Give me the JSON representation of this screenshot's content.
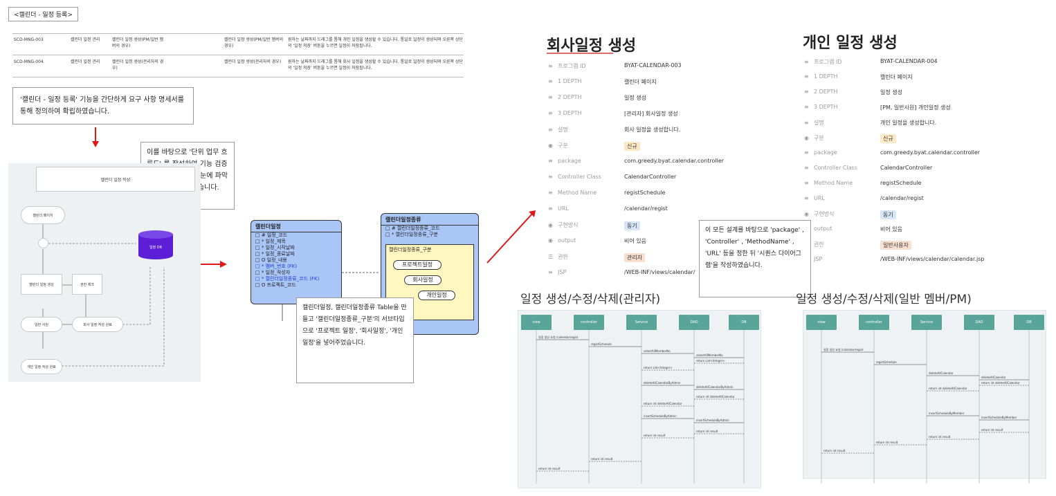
{
  "page_heading": "<캘린더 - 일정 등록>",
  "requirements": [
    {
      "id": "SCD-MNG-003",
      "category": "캘린더 일정 관리",
      "name": "캘린더 일정 생성(PM/일반 멤버의 경우)",
      "func": "캘린더 일정 생성(PM/일반 멤버의 경우)",
      "desc": "원하는 날짜까지 드래그를 통해 개인 일정을 생성할 수 있습니다. 통일로 일정이 생성되며 오른쪽 상단의 '일정 저장' 버튼을 누르면 일정이 저장됩니다."
    },
    {
      "id": "SCD-MNG-004",
      "category": "캘린더 일정 관리",
      "name": "캘린더 일정 생성(관리자의 경우)",
      "func": "캘린더 일정 생성(관리자의 경우)",
      "desc": "원하는 날짜까지 드래그를 통해 회사 일정을 생성할 수 있습니다. 통일로 일정이 생성되며 오른쪽 상단의 '일정 저장' 버튼을 누르면 일정이 저장됩니다."
    }
  ],
  "note1": "'캘린더 - 일정 등록' 기능을 간단하게 요구 사항 명세서를 통해 정의하여 확립하였습니다.",
  "note2": "이를 바탕으로 '단위 업무 흐름도' 를 작성하여 기능 검증을 위한 흐름을 한 눈에 파악할 수 있도록 하였습니다.",
  "note3": "캘린더일정, 캘린더일정종류 Table을 만들고 '캘린더일정종류_구분'의 서브타입으로 '프로젝트 일정', '회사일정', '개인일정'을 넣어주었습니다.",
  "note4": "이 모든 설계를 바탕으로 'package' , 'Controller' , 'MethodName' , 'URL' 등을 정한 뒤 '시퀀스 다이어그램'을 작성하였습니다.",
  "flow": {
    "title": "캘린더 일정 작성",
    "n1": "캘린더 페이지",
    "n2": "캘린더 일정 생성",
    "n3": "권한 체크",
    "n4": "일반 사원",
    "n5": "회사 일정 작성 완료",
    "n6": "개인 일정 작성 완료",
    "db": "일정 DB"
  },
  "erd": {
    "left_title": "캘린더일정",
    "left_fields": [
      "# 일정_코드",
      "* 일정_제목",
      "* 일정_시작날짜",
      "* 일정_종료날짜",
      "O 일정_내용",
      "* 멤버_번호 (FK)",
      "* 일정_작성자",
      "* 캘린더일정종류_코드 (FK)",
      "O 프로젝트_코드"
    ],
    "right_title": "캘린더일정종류",
    "right_fields": [
      "# 캘린더일정종류_코드",
      "* 캘린더일정종류_구분"
    ],
    "subtype_title": "캘린더일정종류_구분",
    "subtypes": [
      "프로젝트일정",
      "회사일정",
      "개인일정"
    ]
  },
  "panel_left": {
    "title": "회사일정 생성",
    "rows": [
      {
        "k": "프로그램 ID",
        "v": "BYAT-CALENDAR-003"
      },
      {
        "k": "1 DEPTH",
        "v": "캘린더 페이지"
      },
      {
        "k": "2 DEPTH",
        "v": "일정 생성"
      },
      {
        "k": "3 DEPTH",
        "v": "[관리자] 회사일정 생성"
      },
      {
        "k": "설명",
        "v": "회사 일정을 생성합니다."
      },
      {
        "k": "구분",
        "v": "신규"
      },
      {
        "k": "package",
        "v": "com.greedy.byat.calendar.controller"
      },
      {
        "k": "Controller Class",
        "v": "CalendarController"
      },
      {
        "k": "Method Name",
        "v": "registSchedule"
      },
      {
        "k": "URL",
        "v": "/calendar/regist"
      },
      {
        "k": "구현방식",
        "v": "동기"
      },
      {
        "k": "output",
        "v": "비어 있음"
      },
      {
        "k": "권한",
        "v": "관리자"
      },
      {
        "k": "JSP",
        "v": "/WEB-INF/views/calendar/"
      }
    ]
  },
  "panel_right": {
    "title": "개인 일정 생성",
    "rows": [
      {
        "k": "프로그램 ID",
        "v": "BYAT-CALENDAR-004"
      },
      {
        "k": "1 DEPTH",
        "v": "캘린더 페이지"
      },
      {
        "k": "2 DEPTH",
        "v": "일정 생성"
      },
      {
        "k": "3 DEPTH",
        "v": "[PM, 일반사원] 개인일정 생성"
      },
      {
        "k": "설명",
        "v": "개인 일정을 생성합니다."
      },
      {
        "k": "구분",
        "v": "신규"
      },
      {
        "k": "package",
        "v": "com.greedy.byat.calendar.controller"
      },
      {
        "k": "Controller Class",
        "v": "CalendarController"
      },
      {
        "k": "Method Name",
        "v": "registSchedule"
      },
      {
        "k": "URL",
        "v": "/calendar/regist"
      },
      {
        "k": "구현방식",
        "v": "동기"
      },
      {
        "k": "output",
        "v": "비어 있음"
      },
      {
        "k": "권한",
        "v": "일반사용자"
      },
      {
        "k": "JSP",
        "v": "/WEB-INF/views/calendar/calendar.jsp"
      }
    ]
  },
  "seq_left": {
    "title": "일정 생성/수정/삭제(관리자)",
    "lifelines": [
      "view",
      "controller",
      "Service",
      "DAO",
      "DB"
    ],
    "msgs": [
      "일정 생성 요청 /calendar/regist",
      "registSchedule",
      "selectAllMemberNo",
      "selectAllMemberNo",
      "return List<Integer>",
      "return List<Integer>",
      "deleteAllCalendarByAdmin",
      "deleteAllCalendarByAdmin",
      "return int deleteAllCalendar",
      "return int deleteAllCalendar",
      "insertScheduleByAdmin",
      "insertScheduleByAdmin",
      "return int result",
      "return int result",
      "return int result",
      "return int result"
    ]
  },
  "seq_right": {
    "title": "일정 생성/수정/삭제(일반 멤버/PM)",
    "lifelines": [
      "view",
      "controller",
      "Service",
      "DAO",
      "DB"
    ],
    "msgs": [
      "일정 생성 요청 /calendar/regist",
      "registSchedule",
      "deleteAllCalendar",
      "deleteAllCalendar",
      "return int deleteAllCalendar",
      "return int deleteAllCalendar",
      "insertScheduleByMember",
      "insertScheduleByMember",
      "return int result",
      "return int result",
      "return int result",
      "return int result"
    ]
  }
}
